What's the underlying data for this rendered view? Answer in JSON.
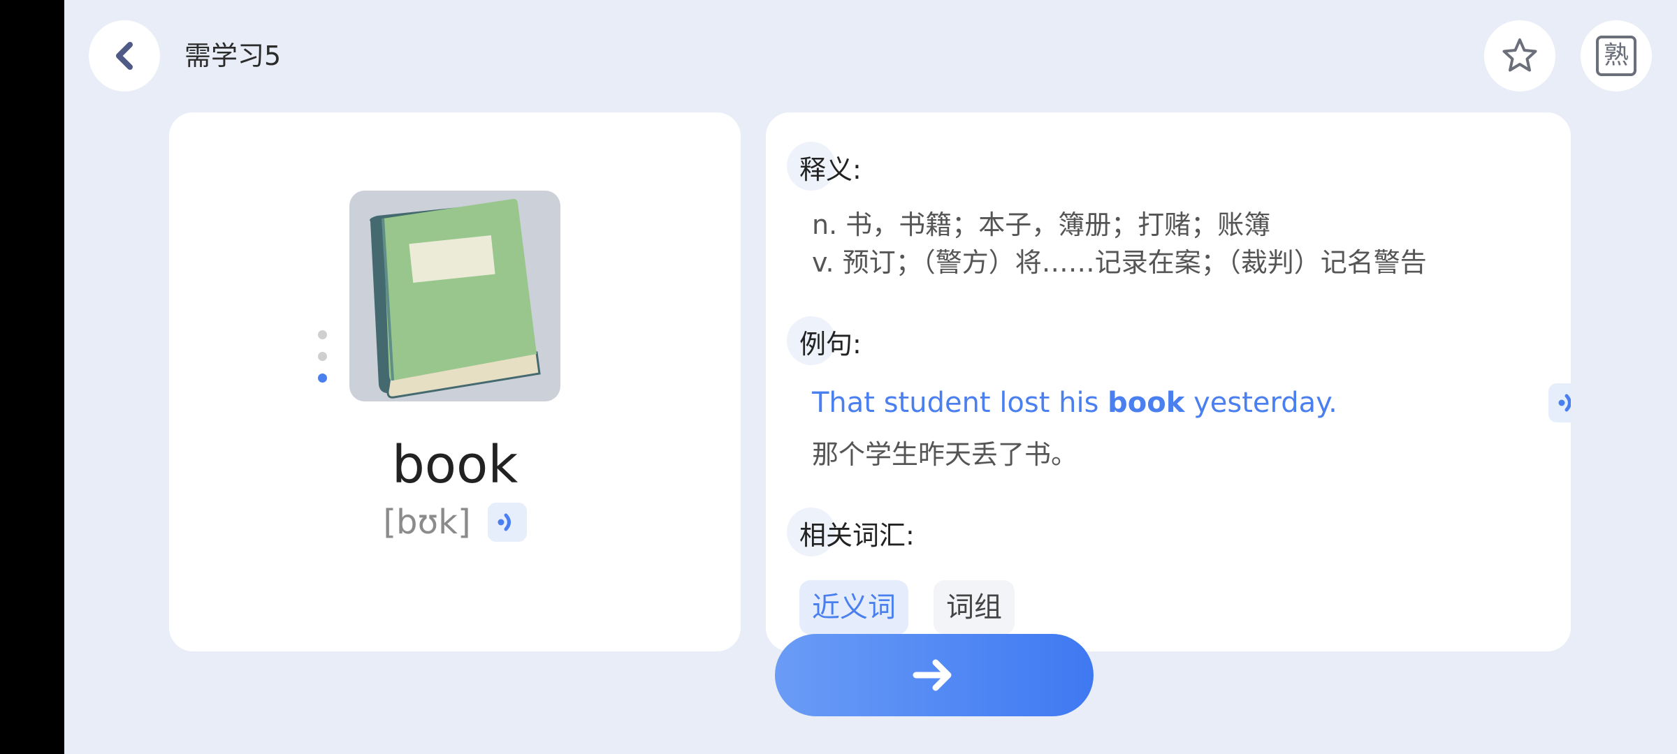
{
  "header": {
    "title": "需学习5",
    "familiar_label": "熟"
  },
  "word_card": {
    "word": "book",
    "phonetic": "[bʊk]",
    "image_icon": "book-illustration",
    "dots": 3,
    "active_dot": 3
  },
  "detail": {
    "definition_title": "释义:",
    "definitions": [
      "n. 书，书籍；本子，簿册；打赌；账簿",
      "v. 预订；（警方）将……记录在案；（裁判）记名警告"
    ],
    "example_title": "例句:",
    "example": {
      "before": "That student lost his ",
      "highlight": "book",
      "after": " yesterday.",
      "translation": "那个学生昨天丢了书。"
    },
    "related_title": "相关词汇:",
    "tabs": [
      "近义词",
      "词组"
    ]
  },
  "icons": {
    "back": "chevron-left-icon",
    "star": "star-icon",
    "speaker": "speaker-icon",
    "next": "arrow-right-icon"
  },
  "colors": {
    "accent": "#4a7ff0",
    "background": "#e8edf7",
    "card": "#ffffff"
  }
}
